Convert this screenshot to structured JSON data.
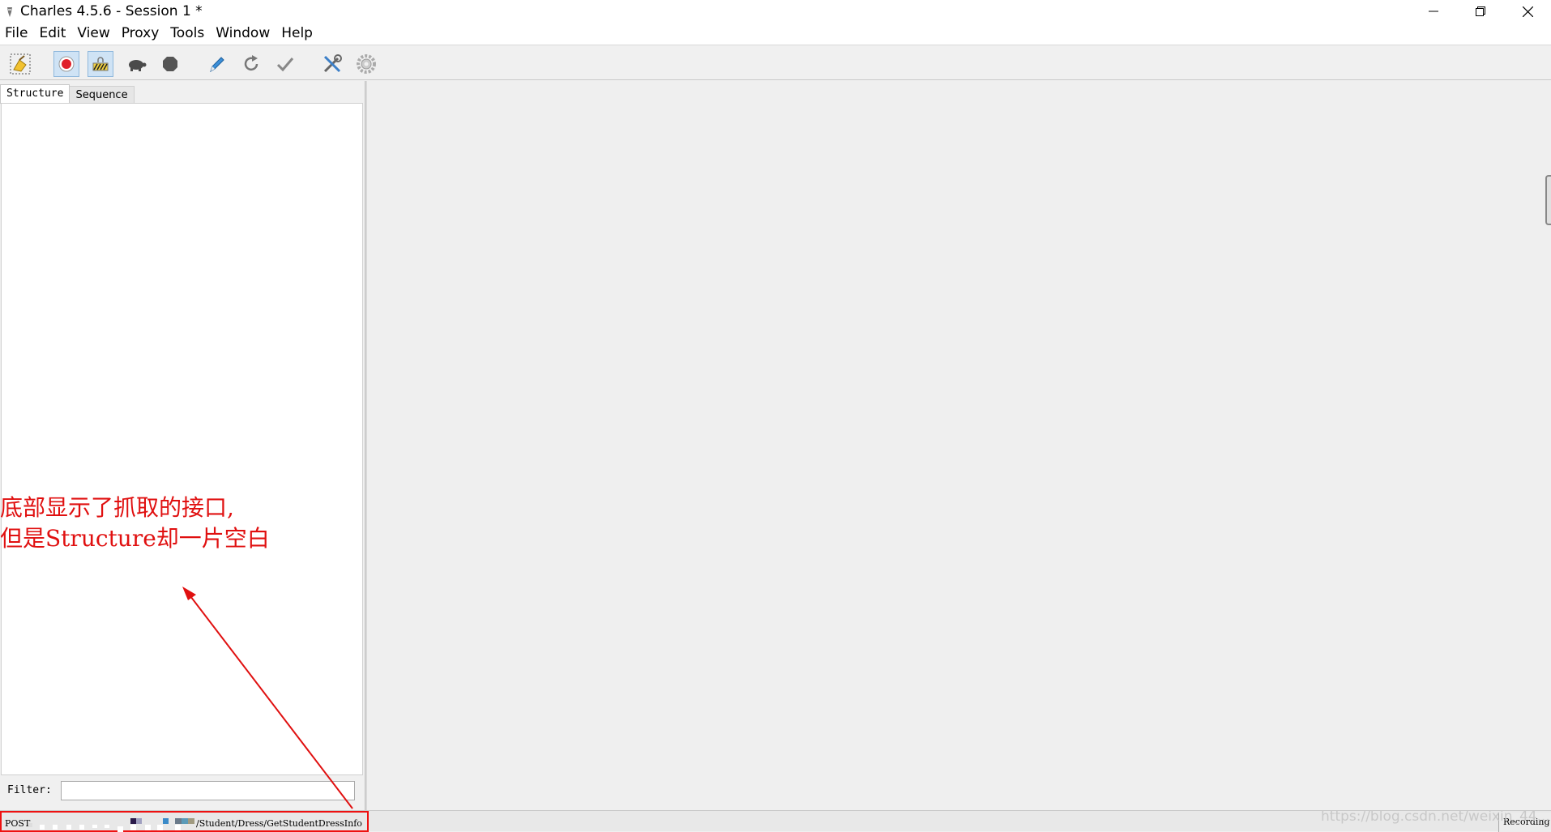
{
  "window": {
    "title": "Charles 4.5.6 - Session 1 *",
    "controls": {
      "minimize": "minimize-icon",
      "maximize": "restore-icon",
      "close": "close-icon"
    }
  },
  "menubar": [
    "File",
    "Edit",
    "View",
    "Proxy",
    "Tools",
    "Window",
    "Help"
  ],
  "toolbar": {
    "icons": [
      "broom-icon",
      "record-icon",
      "ssl-proxying-icon",
      "throttle-turtle-icon",
      "breakpoints-stop-icon",
      "compose-pen-icon",
      "repeat-icon",
      "validate-check-icon",
      "tools-icon",
      "settings-gear-icon"
    ],
    "active": [
      "record-icon",
      "ssl-proxying-icon"
    ]
  },
  "left_pane": {
    "tabs": [
      "Structure",
      "Sequence"
    ],
    "active_tab": "Structure",
    "filter_label": "Filter:",
    "filter_value": ""
  },
  "statusbar": {
    "method": "POST",
    "path": "/Student/Dress/GetStudentDressInfo",
    "recording": "Recording",
    "watermark": "https://blog.csdn.net/weixin_44..."
  },
  "annotation": {
    "line1": "底部显示了抓取的接口,",
    "line2": "但是Structure却一片空白",
    "color": "#e01010"
  },
  "colors": {
    "accent_active": "#cfe3f5",
    "annotation_red": "#e01010"
  }
}
